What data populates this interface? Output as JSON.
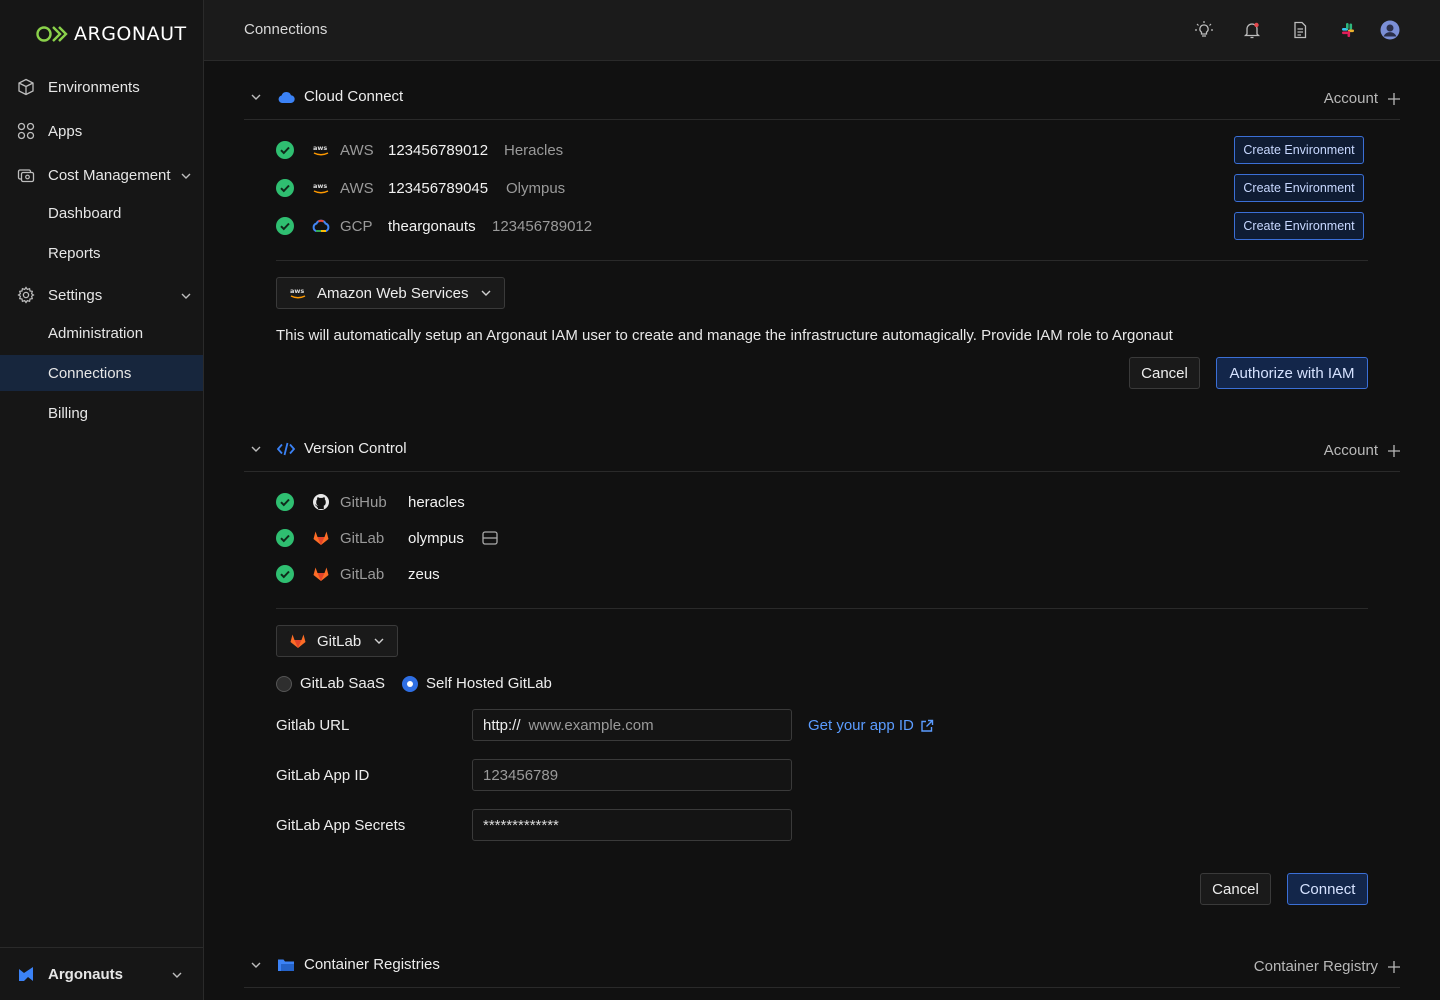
{
  "brand": {
    "name": "ARGONAUT",
    "accent": "#8ad14a"
  },
  "sidebar": {
    "items": [
      {
        "label": "Environments",
        "icon": "cube-icon"
      },
      {
        "label": "Apps",
        "icon": "grid-icon"
      },
      {
        "label": "Cost Management",
        "icon": "cost-icon",
        "expanded": true
      },
      {
        "label": "Dashboard"
      },
      {
        "label": "Reports"
      },
      {
        "label": "Settings",
        "icon": "gear-icon",
        "expanded": true
      },
      {
        "label": "Administration"
      },
      {
        "label": "Connections",
        "active": true
      },
      {
        "label": "Billing"
      }
    ],
    "org": "Argonauts"
  },
  "topbar": {
    "title": "Connections",
    "icons": [
      "theme-bulb-icon",
      "notifications-bell-icon",
      "docs-icon",
      "slack-icon",
      "user-avatar"
    ]
  },
  "cloud": {
    "title": "Cloud Connect",
    "add_label": "Account",
    "rows": [
      {
        "provider": "AWS",
        "account": "123456789012",
        "alias": "Heracles",
        "button": "Create Environment"
      },
      {
        "provider": "AWS",
        "account": "123456789045",
        "alias": "Olympus",
        "button": "Create Environment"
      },
      {
        "provider": "GCP",
        "account": "theargonauts",
        "alias": "123456789012",
        "button": "Create Environment"
      }
    ],
    "selector": "Amazon Web Services",
    "description": "This will automatically setup an Argonaut IAM user to create and manage the infrastructure automagically. Provide IAM role to Argonaut",
    "cancel": "Cancel",
    "authorize": "Authorize with IAM"
  },
  "vcs": {
    "title": "Version Control",
    "add_label": "Account",
    "rows": [
      {
        "provider": "GitHub",
        "account": "heracles"
      },
      {
        "provider": "GitLab",
        "account": "olympus"
      },
      {
        "provider": "GitLab",
        "account": "zeus"
      }
    ],
    "selector": "GitLab",
    "radio_saas": "GitLab SaaS",
    "radio_self": "Self Hosted GitLab",
    "selected_radio": "Self Hosted GitLab",
    "url_label": "Gitlab URL",
    "url_prefix": "http://",
    "url_placeholder": "www.example.com",
    "app_link": "Get your app ID",
    "appid_label": "GitLab App ID",
    "appid_placeholder": "123456789",
    "secret_label": "GitLab App Secrets",
    "secret_value": "*************",
    "cancel": "Cancel",
    "connect": "Connect"
  },
  "registries": {
    "title": "Container Registries",
    "add_label": "Container Registry"
  },
  "colors": {
    "check": "#2fbf71",
    "link": "#5b9cff",
    "primary_border": "#3b6fd6"
  }
}
